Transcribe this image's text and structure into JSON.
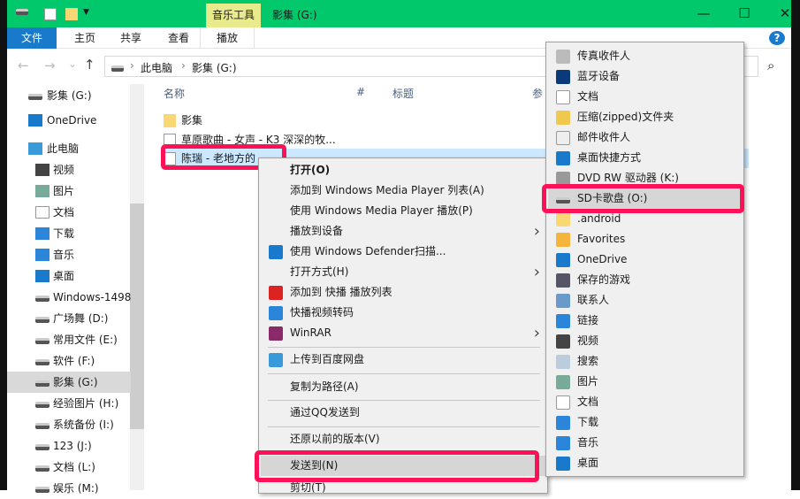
{
  "title_bar": {
    "context_tab": "音乐工具",
    "title": "影集 (G:)",
    "minimize": "—",
    "maximize": "☐",
    "close": "✕"
  },
  "ribbon": {
    "tabs": [
      "文件",
      "主页",
      "共享",
      "查看",
      "播放"
    ],
    "help": "?"
  },
  "address": {
    "crumbs": [
      "此电脑",
      "影集 (G:)"
    ],
    "sep": "›",
    "back": "←",
    "forward": "→",
    "up": "↑",
    "recent": "⌄",
    "search_icon": "⌕"
  },
  "sidebar": {
    "items": [
      "影集 (G:)",
      "OneDrive",
      "此电脑",
      "视频",
      "图片",
      "文档",
      "下载",
      "音乐",
      "桌面",
      "Windows-1498",
      "广场舞 (D:)",
      "常用文件 (E:)",
      "软件  (F:)",
      "影集 (G:)",
      "经验图片 (H:)",
      "系统备份 (I:)",
      "123 (J:)",
      "文档 (L:)",
      "娱乐 (M:)"
    ],
    "selected": 13
  },
  "columns": [
    "名称",
    "#",
    "标题",
    "参"
  ],
  "files": [
    "影集",
    "草原歌曲 - 女声 - K3 深深的牧...",
    "陈瑞 - 老地方的"
  ],
  "context_menu": {
    "items": [
      "打开(O)",
      "添加到 Windows Media Player 列表(A)",
      "使用 Windows Media Player 播放(P)",
      "播放到设备",
      "使用 Windows Defender扫描...",
      "打开方式(H)",
      "添加到 快播 播放列表",
      "快播视频转码",
      "WinRAR",
      "上传到百度网盘",
      "复制为路径(A)",
      "通过QQ发送到",
      "还原以前的版本(V)",
      "发送到(N)",
      "剪切(T)"
    ],
    "highlighted": "发送到(N)"
  },
  "sendto_menu": {
    "items": [
      "传真收件人",
      "蓝牙设备",
      "文档",
      "压缩(zipped)文件夹",
      "邮件收件人",
      "桌面快捷方式",
      "DVD RW 驱动器 (K:)",
      "SD卡歌盘 (O:)",
      ".android",
      "Favorites",
      "OneDrive",
      "保存的游戏",
      "联系人",
      "链接",
      "视频",
      "搜索",
      "图片",
      "文档",
      "下载",
      "音乐",
      "桌面"
    ],
    "highlighted": "SD卡歌盘 (O:)"
  },
  "colors": {
    "titlebar": "#00c86b",
    "accent": "#1979ca",
    "highlight_box": "#ff1158"
  }
}
